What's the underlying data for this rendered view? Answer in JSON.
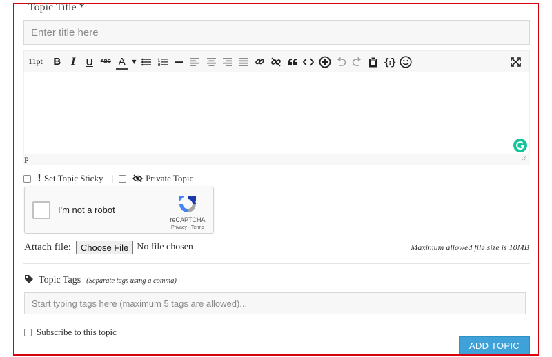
{
  "form": {
    "title_label": "Topic Title *",
    "title_placeholder": "Enter title here",
    "title_value": ""
  },
  "toolbar": {
    "font_size": "11pt",
    "bold": "B",
    "italic": "I",
    "underline": "U",
    "strikethrough": "ABC",
    "font_color": "A",
    "buttons": [
      "font-size",
      "bold",
      "italic",
      "underline",
      "strikethrough",
      "font-color",
      "font-color-dropdown",
      "bullet-list",
      "numbered-list",
      "horizontal-rule",
      "align-left",
      "align-center",
      "align-right",
      "justify",
      "insert-link",
      "remove-link",
      "blockquote",
      "source-code",
      "insert",
      "undo",
      "redo",
      "paste",
      "code-block",
      "emoticons",
      "fullscreen"
    ],
    "font_color_bar": "#444444"
  },
  "editor": {
    "status_path": "P",
    "grammarly_color": "#15c39a"
  },
  "options": {
    "sticky_label": "Set Topic Sticky",
    "separator": "|",
    "private_label": "Private Topic"
  },
  "recaptcha": {
    "label": "I'm not a robot",
    "brand": "reCAPTCHA",
    "links": "Privacy - Terms"
  },
  "attachment": {
    "label": "Attach file:",
    "button": "Choose File",
    "status": "No file chosen",
    "max_size": "Maximum allowed file size is 10MB"
  },
  "tags": {
    "label": "Topic Tags",
    "hint": "(Separate tags using a comma)",
    "placeholder": "Start typing tags here (maximum 5 tags are allowed)..."
  },
  "subscribe": {
    "label": "Subscribe to this topic"
  },
  "submit": {
    "label": "ADD TOPIC",
    "color": "#3ea2d9"
  },
  "colors": {
    "frame_border": "#d9000d",
    "input_bg": "#f7f7f7"
  }
}
